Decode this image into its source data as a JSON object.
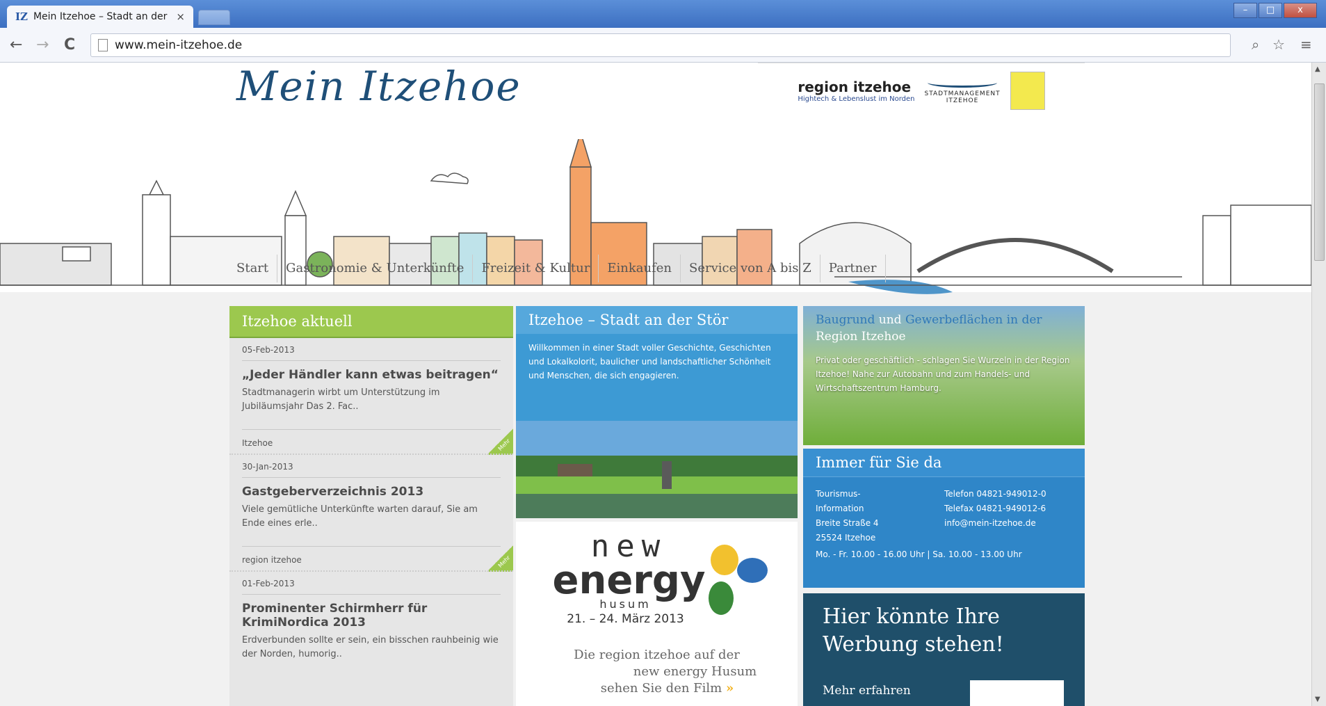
{
  "browser": {
    "tab_favicon": "IZ",
    "tab_title": "Mein Itzehoe – Stadt an der",
    "tab_close": "×",
    "url": "www.mein-itzehoe.de",
    "back_icon": "←",
    "forward_icon": "→",
    "reload_icon": "C",
    "zoom_icon": "⌕",
    "star_icon": "☆",
    "menu_icon": "≡",
    "minimize": "–",
    "maximize": "□",
    "close": "x"
  },
  "header": {
    "logo": "Mein Itzehoe",
    "region_title": "region itzehoe",
    "region_sub": "Hightech & Lebenslust im Norden",
    "stadtmanagement": "STADTMANAGEMENT",
    "stadtmanagement_sub": "ITZEHOE"
  },
  "nav": [
    "Start",
    "Gastronomie & Unterkünfte",
    "Freizeit & Kultur",
    "Einkaufen",
    "Service von A bis Z",
    "Partner"
  ],
  "news": {
    "heading": "Itzehoe aktuell",
    "mehr": "Mehr",
    "items": [
      {
        "date": "05-Feb-2013",
        "title": "„Jeder Händler kann etwas beitragen“",
        "text": "Stadtmanagerin wirbt um Unterstützung im Jubiläumsjahr Das 2. Fac..",
        "source": "Itzehoe"
      },
      {
        "date": "30-Jan-2013",
        "title": "Gastgeberverzeichnis 2013",
        "text": "Viele gemütliche Unterkünfte warten darauf, Sie am Ende eines erle..",
        "source": "region itzehoe"
      },
      {
        "date": "01-Feb-2013",
        "title": "Prominenter Schirmherr für KrimiNordica 2013",
        "text": "Erdverbunden sollte er sein, ein bisschen rauhbeinig wie der Norden, humorig..",
        "source": ""
      }
    ]
  },
  "city": {
    "heading": "Itzehoe – Stadt an der Stör",
    "text": "Willkommen in einer Stadt voller Geschichte, Geschichten und Lokalkolorit, baulicher und landschaftlicher Schönheit und Menschen, die sich engagieren."
  },
  "energy": {
    "new": "new",
    "energy": "energy",
    "husum": "husum",
    "date": "21. – 24. März 2013",
    "line1": "Die region itzehoe auf der",
    "line2": "new energy Husum",
    "line3": "sehen Sie den Film",
    "arrow": "»"
  },
  "baugrund": {
    "h_part1": "Baugrund",
    "h_und": "und",
    "h_part2": "Gewerbeflächen",
    "h_in": "in der",
    "h_part3": "Region Itzehoe",
    "text": "Privat oder geschäftlich - schlagen Sie Wurzeln in der Region Itzehoe! Nahe zur Autobahn und zum Handels- und Wirtschaftszentrum Hamburg."
  },
  "contact": {
    "heading": "Immer für Sie da",
    "left": [
      "Tourismus-",
      "Information",
      "Breite Straße 4",
      "25524 Itzehoe"
    ],
    "right": [
      "Telefon 04821-949012-0",
      "Telefax 04821-949012-6",
      "info@mein-itzehoe.de"
    ],
    "hours": "Mo. - Fr. 10.00 - 16.00 Uhr | Sa. 10.00 - 13.00 Uhr"
  },
  "ad": {
    "line1": "Hier könnte Ihre",
    "line2": "Werbung stehen!",
    "mehr": "Mehr erfahren"
  }
}
